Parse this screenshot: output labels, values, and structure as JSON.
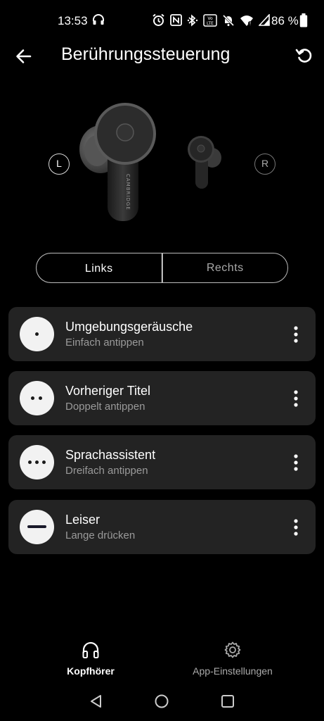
{
  "status": {
    "time": "13:53",
    "battery": "86 %",
    "icons": [
      "headset-icon",
      "alarm-icon",
      "nfc-icon",
      "bluetooth-icon",
      "volte-icon",
      "mute-icon",
      "wifi-icon",
      "signal-icon",
      "battery-icon"
    ]
  },
  "header": {
    "title": "Berührungssteuerung",
    "back_icon": "arrow-left-icon",
    "reset_icon": "reset-icon"
  },
  "earbuds": {
    "left_badge": "L",
    "right_badge": "R",
    "brand_text": "CAMBRIDGE"
  },
  "tabs": [
    {
      "label": "Links",
      "active": true
    },
    {
      "label": "Rechts",
      "active": false
    }
  ],
  "gestures": [
    {
      "title": "Umgebungsgeräusche",
      "subtitle": "Einfach antippen",
      "icon": "single-tap-icon"
    },
    {
      "title": "Vorheriger Titel",
      "subtitle": "Doppelt antippen",
      "icon": "double-tap-icon"
    },
    {
      "title": "Sprachassistent",
      "subtitle": "Dreifach antippen",
      "icon": "triple-tap-icon"
    },
    {
      "title": "Leiser",
      "subtitle": "Lange drücken",
      "icon": "long-press-icon"
    }
  ],
  "bottom_nav": {
    "headphones": {
      "label": "Kopfhörer",
      "active": true
    },
    "settings": {
      "label": "App-Einstellungen",
      "active": false
    }
  },
  "colors": {
    "background": "#000000",
    "card": "#232323",
    "icon_circle": "#f2f2f2",
    "subtitle": "#9a9a9a"
  }
}
